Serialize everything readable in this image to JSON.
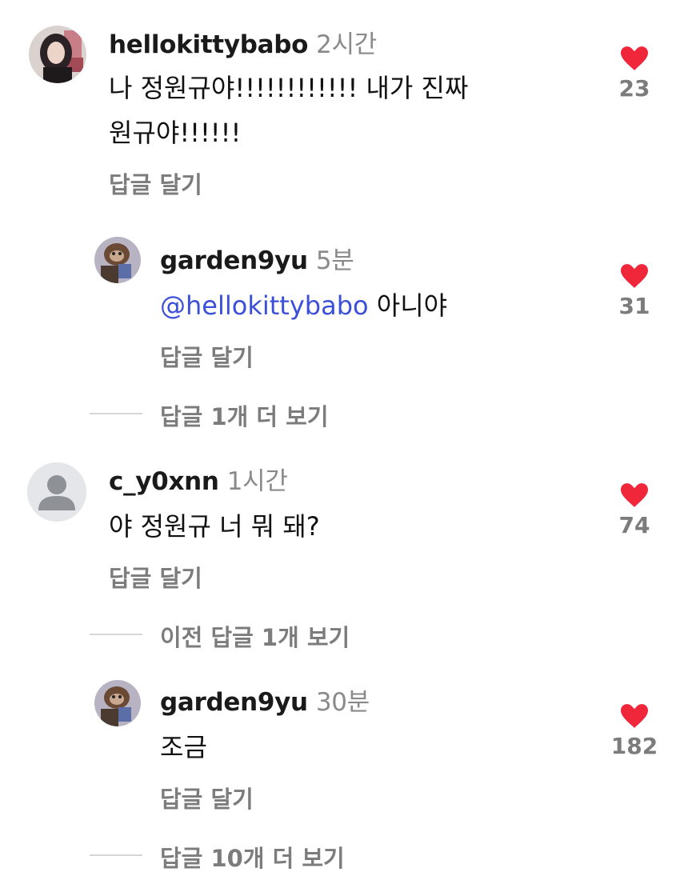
{
  "comments": [
    {
      "username": "hellokittybabo",
      "time": "2시간",
      "text_line1": "나 정원규야!!!!!!!!!!!! 내가 진짜",
      "text_line2": "원규야!!!!!!",
      "reply_label": "답글 달기",
      "likes": "23",
      "avatar_icon": "profile-photo"
    },
    {
      "username": "garden9yu",
      "time": "5분",
      "mention": "@hellokittybabo",
      "text": " 아니야",
      "reply_label": "답글 달기",
      "likes": "31",
      "avatar_icon": "profile-photo"
    },
    {
      "more_label": "답글 1개 더 보기"
    },
    {
      "username": "c_y0xnn",
      "time": "1시간",
      "text": "야 정원규 너 뭐 돼?",
      "reply_label": "답글 달기",
      "likes": "74",
      "avatar_icon": "default-user-icon"
    },
    {
      "prev_label": "이전 답글 1개 보기"
    },
    {
      "username": "garden9yu",
      "time": "30분",
      "text": "조금",
      "reply_label": "답글 달기",
      "likes": "182",
      "avatar_icon": "profile-photo"
    },
    {
      "more_label": "답글 10개 더 보기"
    }
  ],
  "colors": {
    "heart": "#f0263a",
    "mention": "#3b4fd9",
    "muted": "#7c7c7c"
  }
}
